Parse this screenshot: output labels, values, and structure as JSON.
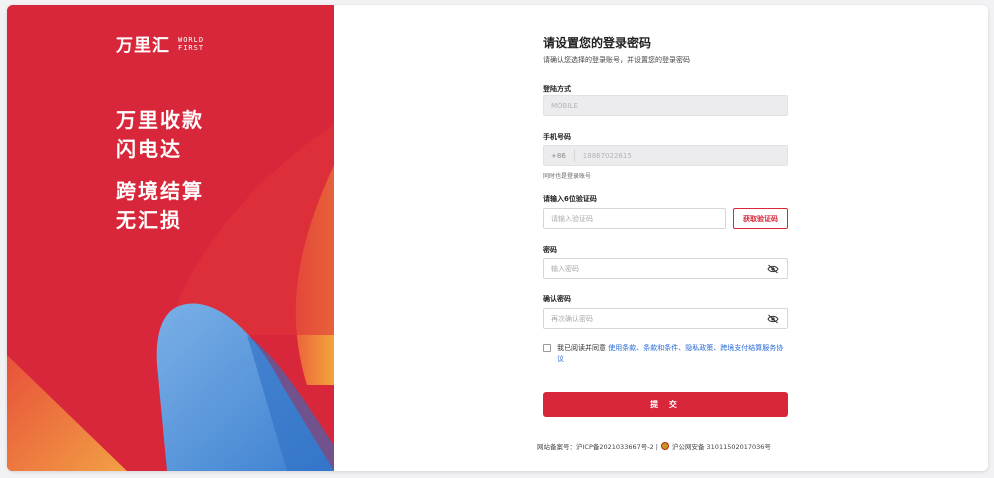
{
  "brand": {
    "logo_cn": "万里汇",
    "logo_en_line1": "WORLD",
    "logo_en_line2": "FIRST",
    "slogan1_line1": "万里收款",
    "slogan1_line2": "闪电达",
    "slogan2_line1": "跨境结算",
    "slogan2_line2": "无汇损"
  },
  "form": {
    "title": "请设置您的登录密码",
    "subtitle": "请确认您选择的登录账号，并设置您的登录密码",
    "login_method_label": "登陆方式",
    "login_method_value": "MOBILE",
    "phone_label": "手机号码",
    "country_code": "+86",
    "phone_value": "18867022615",
    "phone_hint": "同时也是登录账号",
    "code_label": "请输入6位验证码",
    "code_placeholder": "请输入验证码",
    "get_code_label": "获取验证码",
    "password_label": "密码",
    "password_placeholder": "输入密码",
    "confirm_label": "确认密码",
    "confirm_placeholder": "再次确认密码",
    "agree_prefix": "我已阅读并同意",
    "agree_links": "使用条款、条款和条件、隐私政策、跨境支付结算服务协议",
    "submit_label": "提 交"
  },
  "footer": {
    "icp": "网站备案号：沪ICP备2021033667号-2 |",
    "police": "沪公网安备 31011502017036号"
  },
  "colors": {
    "brand_red": "#d8273a",
    "link_blue": "#2a6ad8"
  },
  "icons": {
    "password_toggle": "eye-off-icon",
    "footer_badge": "police-badge-icon"
  }
}
